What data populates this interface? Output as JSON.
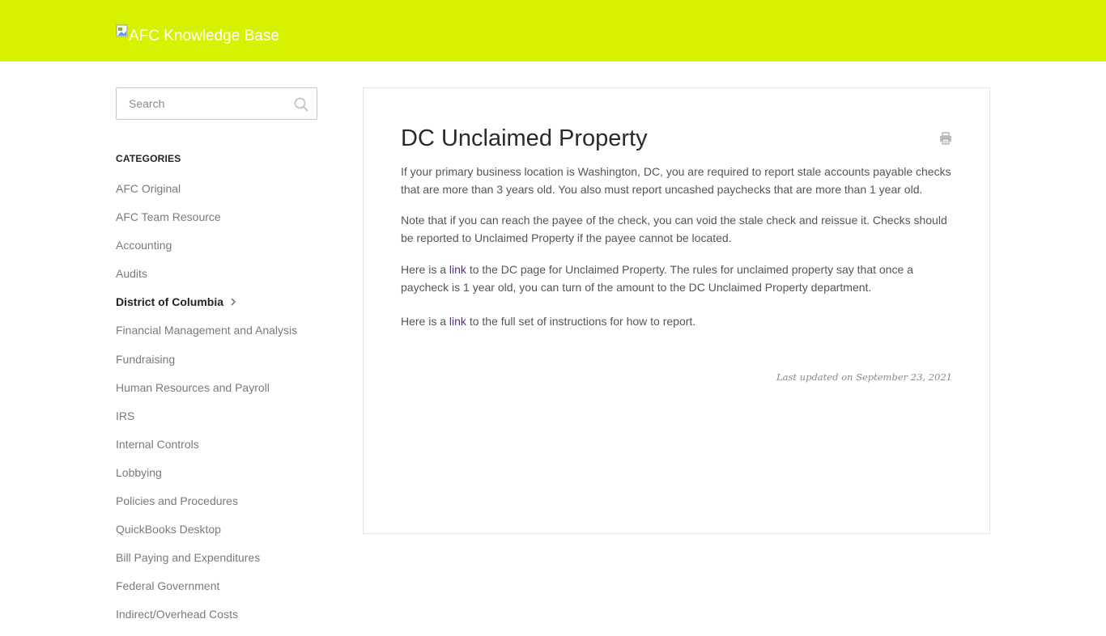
{
  "header": {
    "logo_alt_text": "AFC Knowledge Base",
    "background_color": "#d6f200"
  },
  "search": {
    "placeholder": "Search",
    "icon": "search-icon"
  },
  "sidebar": {
    "title": "CATEGORIES",
    "items": [
      {
        "label": "AFC Original",
        "active": false
      },
      {
        "label": "AFC Team Resource",
        "active": false
      },
      {
        "label": "Accounting",
        "active": false
      },
      {
        "label": "Audits",
        "active": false
      },
      {
        "label": "District of Columbia",
        "active": true
      },
      {
        "label": "Financial Management and Analysis",
        "active": false
      },
      {
        "label": "Fundraising",
        "active": false
      },
      {
        "label": "Human Resources and Payroll",
        "active": false
      },
      {
        "label": "IRS",
        "active": false
      },
      {
        "label": "Internal Controls",
        "active": false
      },
      {
        "label": "Lobbying",
        "active": false
      },
      {
        "label": "Policies and Procedures",
        "active": false
      },
      {
        "label": "QuickBooks Desktop",
        "active": false
      },
      {
        "label": "Bill Paying and Expenditures",
        "active": false
      },
      {
        "label": "Federal Government",
        "active": false
      },
      {
        "label": "Indirect/Overhead Costs",
        "active": false
      }
    ]
  },
  "article": {
    "title": "DC Unclaimed Property",
    "print_icon": "print-icon",
    "p1": "If your primary business location is Washington, DC, you are required to report stale accounts payable checks that are more than 3 years old.  You also must report uncashed paychecks that are more than 1 year old.",
    "p2": "Note that if you can reach the payee of the check, you can void the stale check and reissue it.  Checks should be reported to Unclaimed Property if the payee cannot be located.",
    "p3_before": "Here is a ",
    "p3_link": "link",
    "p3_after": " to the DC page for Unclaimed Property.  The rules for unclaimed property say that once a paycheck is 1 year old, you can turn of the amount to the DC Unclaimed Property department.",
    "p4_before": "Here is a ",
    "p4_link": "link",
    "p4_after": " to the full set of instructions for how to report.",
    "last_updated": "Last updated on September 23, 2021",
    "link_color": "#5b2c87"
  }
}
